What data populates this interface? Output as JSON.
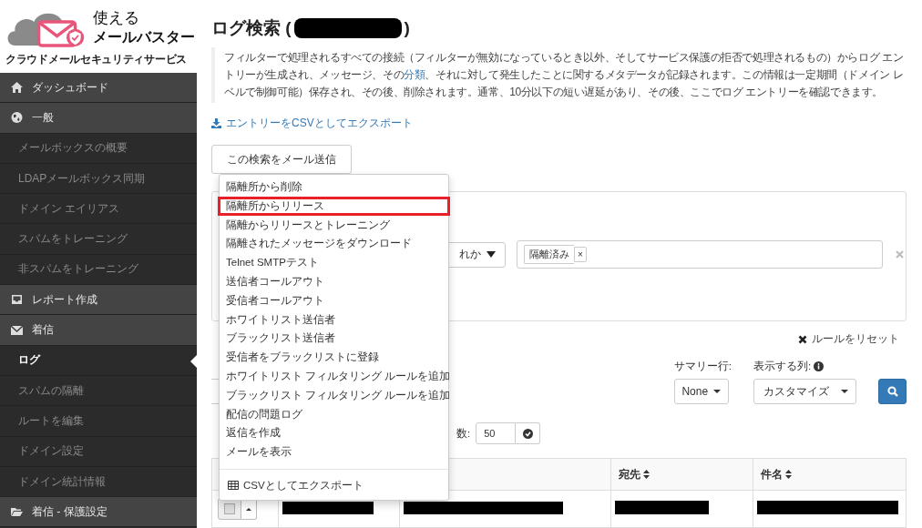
{
  "logo": {
    "line1": "使える",
    "line2": "メールバスター",
    "tagline": "クラウドメールセキュリティサービス"
  },
  "sidebar": {
    "items": [
      {
        "kind": "section",
        "label": "ダッシュボード",
        "selected": false
      },
      {
        "kind": "section",
        "label": "一般",
        "selected": false
      },
      {
        "kind": "sub",
        "label": "メールボックスの概要",
        "selected": false
      },
      {
        "kind": "sub",
        "label": "LDAPメールボックス同期",
        "selected": false
      },
      {
        "kind": "sub",
        "label": "ドメイン エイリアス",
        "selected": false
      },
      {
        "kind": "sub",
        "label": "スパムをトレーニング",
        "selected": false
      },
      {
        "kind": "sub",
        "label": "非スパムをトレーニング",
        "selected": false
      },
      {
        "kind": "section",
        "label": "レポート作成",
        "selected": false
      },
      {
        "kind": "section",
        "label": "着信",
        "selected": false
      },
      {
        "kind": "sub",
        "label": "ログ",
        "selected": true
      },
      {
        "kind": "sub",
        "label": "スパムの隔離",
        "selected": false
      },
      {
        "kind": "sub",
        "label": "ルートを編集",
        "selected": false
      },
      {
        "kind": "sub",
        "label": "ドメイン設定",
        "selected": false
      },
      {
        "kind": "sub",
        "label": "ドメイン統計情報",
        "selected": false
      },
      {
        "kind": "section",
        "label": "着信 - 保護設定",
        "selected": false
      }
    ]
  },
  "page": {
    "title": "ログ検索 (",
    "title_close": ")",
    "description": {
      "before": "フィルターで処理されるすべての接続（フィルターが無効になっているとき以外、そしてサービス保護の拒否で処理されるもの）からログ エントリーが生成され、メッセージ、その",
      "link": "分類",
      "after": "、それに対して発生したことに関するメタデータが記録されます。この情報は一定期間（ドメイン レベルで制御可能）保存され、その後、削除されます。通常、10分以下の短い遅延があり、その後、ここでログ エントリーを確認できます。"
    },
    "export_link": "エントリーをCSVとしてエクスポート",
    "email_button": "この検索をメール送信"
  },
  "menu": {
    "items": [
      {
        "label": "隔離所から削除",
        "highlighted": false
      },
      {
        "label": "隔離所からリリース",
        "highlighted": true
      },
      {
        "label": "隔離からリリースとトレーニング",
        "highlighted": false
      },
      {
        "label": "隔離されたメッセージをダウンロード",
        "highlighted": false
      },
      {
        "label": "Telnet SMTPテスト",
        "highlighted": false
      },
      {
        "label": "送信者コールアウト",
        "highlighted": false
      },
      {
        "label": "受信者コールアウト",
        "highlighted": false
      },
      {
        "label": "ホワイトリスト送信者",
        "highlighted": false
      },
      {
        "label": "ブラックリスト送信者",
        "highlighted": false
      },
      {
        "label": "受信者をブラックリストに登録",
        "highlighted": false
      },
      {
        "label": "ホワイトリスト フィルタリング ルールを追加",
        "highlighted": false
      },
      {
        "label": "ブラックリスト フィルタリング ルールを追加",
        "highlighted": false
      },
      {
        "label": "配信の問題ログ",
        "highlighted": false
      },
      {
        "label": "返信を作成",
        "highlighted": false
      },
      {
        "label": "メールを表示",
        "highlighted": false
      }
    ],
    "footer": "CSVとしてエクスポート"
  },
  "filter": {
    "operator_value": "れか",
    "tag": "隔離済み",
    "tag_remove": "×",
    "reset": "ルールをリセット"
  },
  "controls": {
    "summary_label": "サマリー行:",
    "summary_value": "None",
    "columns_label": "表示する列:",
    "columns_value": "カスタマイズ",
    "page_size_label": "数:",
    "page_size_value": "50"
  },
  "table": {
    "columns": [
      {
        "label": "宛先"
      },
      {
        "label": "件名"
      }
    ],
    "rows": [
      {
        "checked": false
      }
    ]
  }
}
